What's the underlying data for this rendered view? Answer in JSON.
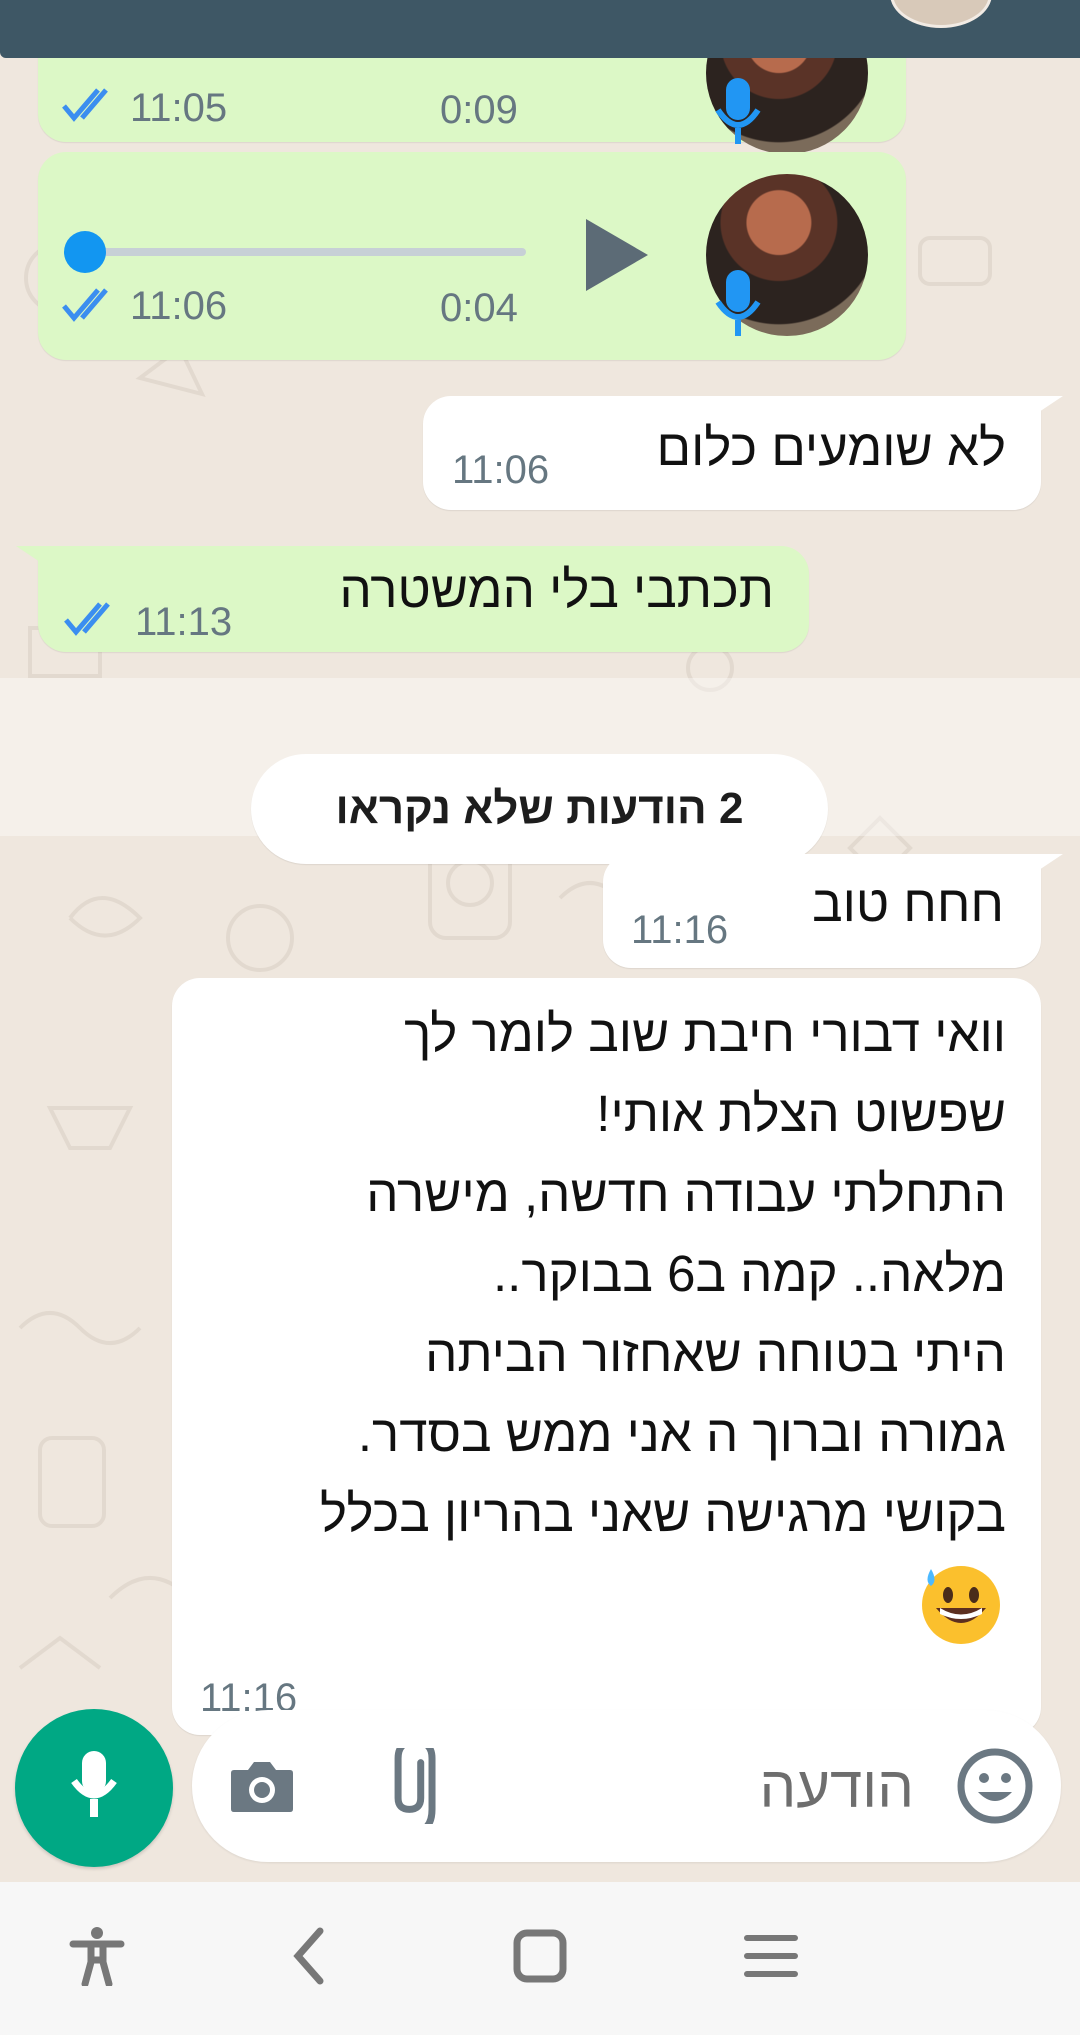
{
  "colors": {
    "header": "#3e5765",
    "outgoing_bubble": "#dcf8c6",
    "incoming_bubble": "#ffffff",
    "chat_background": "#efe7de",
    "accent_green": "#00a884",
    "read_ticks": "#3b8ef0"
  },
  "messages": [
    {
      "kind": "voice",
      "direction": "outgoing",
      "time": "11:05",
      "duration": "0:09",
      "status_icon": "double-check-icon"
    },
    {
      "kind": "voice",
      "direction": "outgoing",
      "time": "11:06",
      "duration": "0:04",
      "progress": 0,
      "status_icon": "double-check-icon"
    },
    {
      "kind": "text",
      "direction": "incoming",
      "text": "לא שומעים כלום",
      "time": "11:06"
    },
    {
      "kind": "text",
      "direction": "outgoing",
      "text": "תכתבי בלי המשטרה",
      "time": "11:13",
      "status_icon": "double-check-icon"
    },
    {
      "kind": "text",
      "direction": "incoming",
      "text": "חחח טוב",
      "time": "11:16"
    },
    {
      "kind": "text",
      "direction": "incoming",
      "lines": [
        "וואי דבורי חיבת שוב לומר לך",
        "שפשוט הצלת אותי!",
        "התחלתי עבודה חדשה, מישרה",
        "מלאה.. קמה ב6 בבוקר..",
        "היתי בטוחה שאחזור הביתה",
        "גמורה וברוך ה אני ממש בסדר.",
        "בקושי מרגישה שאני בהריון בכלל"
      ],
      "emoji": "grinning-face-with-sweat-emoji",
      "time": "11:16"
    }
  ],
  "unread_divider": "2 הודעות שלא נקראו",
  "composer": {
    "placeholder": "הודעה",
    "icons": [
      "emoji-icon",
      "attach-icon",
      "camera-icon",
      "mic-icon"
    ]
  },
  "nav_bar": {
    "icons": [
      "accessibility-icon",
      "back-icon",
      "home-icon",
      "recents-icon"
    ]
  }
}
